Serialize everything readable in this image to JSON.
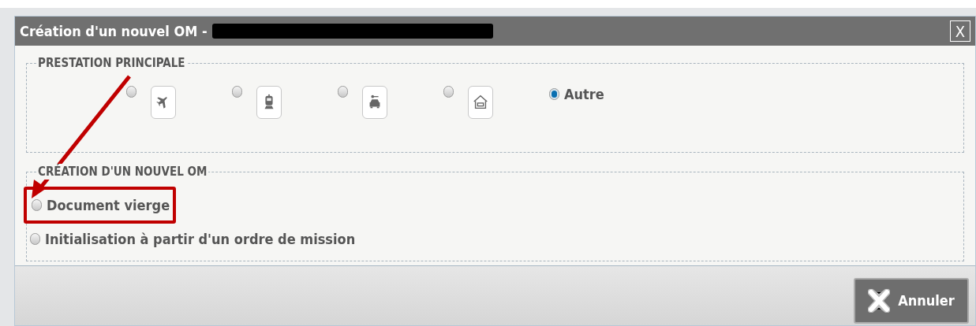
{
  "dialog": {
    "title": "Création d'un nouvel OM -",
    "close": "X"
  },
  "prestation": {
    "legend": "PRESTATION PRINCIPALE",
    "options": [
      {
        "kind": "icon",
        "selected": false
      },
      {
        "kind": "icon",
        "selected": false
      },
      {
        "kind": "icon",
        "selected": false
      },
      {
        "kind": "icon",
        "selected": false
      },
      {
        "kind": "text",
        "label": "Autre",
        "selected": true
      }
    ]
  },
  "creation": {
    "legend": "CRÉATION D'UN NOUVEL OM",
    "options": [
      {
        "label": "Document vierge",
        "selected": false,
        "highlighted": true
      },
      {
        "label": "Initialisation à partir d'un ordre de mission",
        "selected": false,
        "highlighted": false
      }
    ]
  },
  "footer": {
    "buttons": [
      {
        "label": "Annuler"
      }
    ]
  }
}
